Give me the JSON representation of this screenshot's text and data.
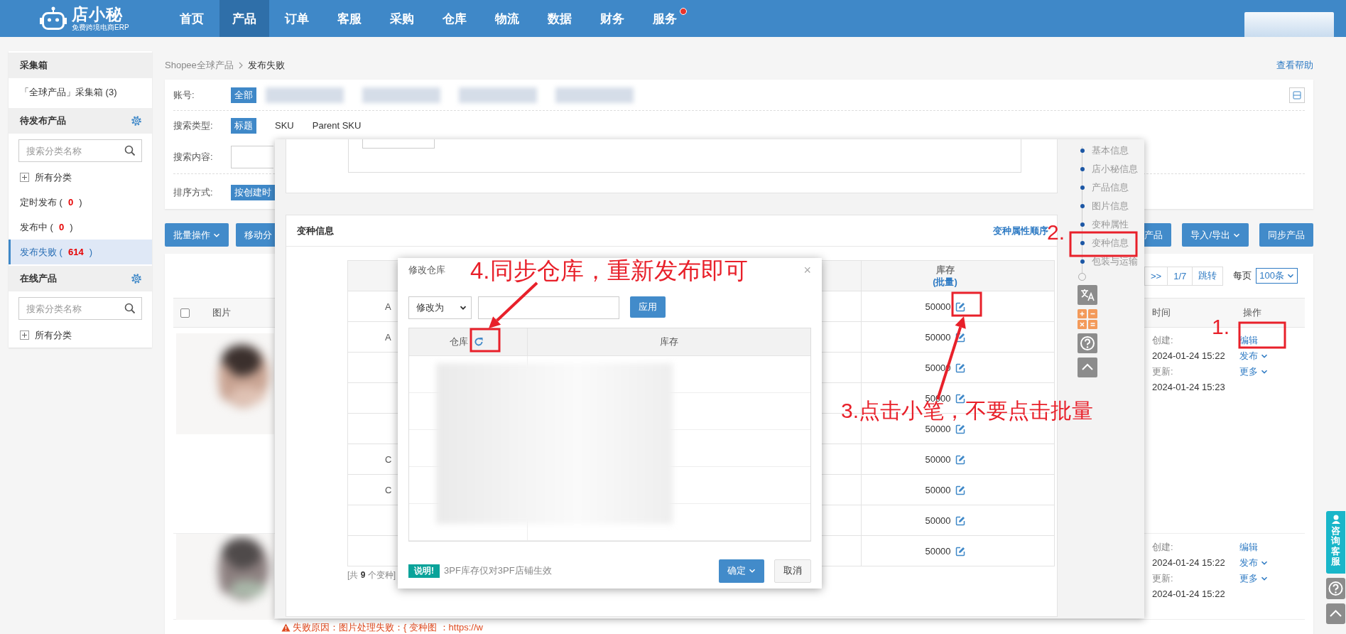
{
  "top_nav": {
    "logo_name": "店小秘",
    "logo_tagline": "免费跨境电商ERP",
    "items": [
      {
        "label": "首页",
        "selected": false,
        "badge": false
      },
      {
        "label": "产品",
        "selected": true,
        "badge": false
      },
      {
        "label": "订单",
        "selected": false,
        "badge": false
      },
      {
        "label": "客服",
        "selected": false,
        "badge": false
      },
      {
        "label": "采购",
        "selected": false,
        "badge": false
      },
      {
        "label": "仓库",
        "selected": false,
        "badge": false
      },
      {
        "label": "物流",
        "selected": false,
        "badge": false
      },
      {
        "label": "数据",
        "selected": false,
        "badge": false
      },
      {
        "label": "财务",
        "selected": false,
        "badge": false
      },
      {
        "label": "服务",
        "selected": false,
        "badge": true
      }
    ]
  },
  "sidebar": {
    "sections": [
      {
        "title": "采集箱",
        "settings": false,
        "items": [
          {
            "kind": "link",
            "label": "「全球产品」采集箱 (3)",
            "selected": false
          }
        ]
      },
      {
        "title": "待发布产品",
        "settings": true,
        "search_placeholder": "搜索分类名称",
        "items": [
          {
            "kind": "tree",
            "label": "所有分类",
            "selected": false
          },
          {
            "kind": "count",
            "label": "定时发布 (**0**)",
            "selected": false
          },
          {
            "kind": "count",
            "label": "发布中 (**0**)",
            "selected": false
          },
          {
            "kind": "count",
            "label": "发布失败 (**614**)",
            "selected": true
          }
        ]
      },
      {
        "title": "在线产品",
        "settings": true,
        "search_placeholder": "搜索分类名称",
        "items": [
          {
            "kind": "tree",
            "label": "所有分类",
            "selected": false
          }
        ]
      }
    ]
  },
  "breadcrumb": {
    "items": [
      "Shopee全球产品",
      "发布失败"
    ],
    "help_link": "查看帮助"
  },
  "filters": {
    "account": {
      "label": "账号:",
      "options": [
        {
          "label": "全部",
          "selected": true
        }
      ]
    },
    "search_type": {
      "label": "搜索类型:",
      "options": [
        {
          "label": "标题",
          "selected": true
        },
        {
          "label": "SKU",
          "selected": false
        },
        {
          "label": "Parent SKU",
          "selected": false
        }
      ]
    },
    "search_content": {
      "label": "搜索内容:"
    },
    "sort": {
      "label": "排序方式:",
      "options": [
        {
          "label": "按创建时",
          "selected": true
        }
      ]
    }
  },
  "toolbar": {
    "left": [
      {
        "label": "批量操作",
        "caret": true
      },
      {
        "label": "移动分",
        "caret": false
      }
    ],
    "right": [
      {
        "label": "产品",
        "caret": false
      },
      {
        "label": "导入/导出",
        "caret": true
      },
      {
        "label": "同步产品",
        "caret": false
      }
    ]
  },
  "pagination": {
    "items": [
      ">>",
      "1/7",
      "跳转"
    ],
    "per_page_label": "每页",
    "per_page": "100条"
  },
  "product_table": {
    "select_all": {
      "checked": false
    },
    "columns": [
      "图片",
      "时间",
      "操作"
    ],
    "rows": [
      {
        "picture": {
          "kind": "picture"
        },
        "created_label": "创建:",
        "created": "2024-01-24 15:22",
        "updated_label": "更新:",
        "updated": "2024-01-24 15:23",
        "actions": [
          {
            "label": "编辑",
            "caret": false
          },
          {
            "label": "发布",
            "caret": true
          },
          {
            "label": "更多",
            "caret": true
          }
        ]
      },
      {
        "picture": {
          "kind": "picture"
        },
        "created_label": "创建:",
        "created": "2024-01-24 15:22",
        "updated_label": "更新:",
        "updated": "2024-01-24 15:22",
        "actions": [
          {
            "label": "编辑",
            "caret": false
          },
          {
            "label": "发布",
            "caret": true
          },
          {
            "label": "更多",
            "caret": true
          }
        ]
      }
    ],
    "fail_reason": "失败原因：图片处理失败：{ 变种图 ：https://w"
  },
  "edit_modal": {
    "variants": {
      "title": "变种信息",
      "order_link": "变种属性顺序",
      "stock_header": "库存",
      "batch_link": "(批量)",
      "rows": [
        {
          "name": "A",
          "stock": "50000"
        },
        {
          "name": "A",
          "stock": "50000"
        },
        {
          "stock": "50000"
        },
        {
          "stock": "50000"
        },
        {
          "stock": "50000"
        },
        {
          "name": "C",
          "stock": "50000"
        },
        {
          "name": "C",
          "stock": "50000"
        },
        {
          "stock": "50000"
        },
        {
          "stock": "50000"
        }
      ],
      "total": "[共 **9** 个变种]"
    },
    "section_nav": [
      "基本信息",
      "店小秘信息",
      "产品信息",
      "图片信息",
      "变种属性",
      "变种信息",
      "包装与运输"
    ]
  },
  "warehouse_dialog": {
    "title": "修改仓库",
    "close": "×",
    "mode": "修改为",
    "apply": "应用",
    "columns": [
      "仓库",
      "库存"
    ],
    "note_badge": "说明!",
    "note": "3PF库存仅对3PF店铺生效",
    "confirm": "确定",
    "cancel": "取消"
  },
  "annotations": [
    "4.同步仓库，重新发布即可",
    "3.点击小笔，不要点击批量",
    "2.",
    "1."
  ],
  "side_tools": {
    "chat": "咨询客服"
  }
}
